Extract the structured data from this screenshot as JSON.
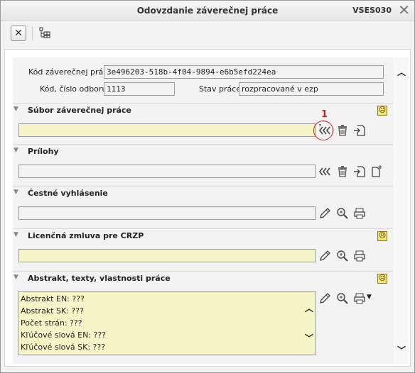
{
  "window": {
    "title": "Odovzdanie záverečnej práce",
    "app_code": "VSES030"
  },
  "header_fields": {
    "thesis_code_label": "Kód záverečnej práce",
    "thesis_code_value": "3e496203-518b-4f04-9894-e6b5efd224ea",
    "dept_code_label": "Kód, číslo odboru",
    "dept_code_value": "1113",
    "status_label": "Stav práce",
    "status_value": "rozpracované v ezp"
  },
  "sections": {
    "thesis_file": {
      "title": "Súbor záverečnej práce",
      "value": ""
    },
    "attachments": {
      "title": "Prílohy",
      "value": ""
    },
    "declaration": {
      "title": "Čestné vyhlásenie",
      "value": ""
    },
    "license": {
      "title": "Licenčná zmluva pre CRZP",
      "value": ""
    },
    "abstract": {
      "title": "Abstrakt, texty, vlastnosti práce",
      "lines": [
        "Abstrakt EN: ???",
        "Abstrakt SK: ???",
        "Počet strán: ???",
        "Kľúčové slová EN: ???",
        "Kľúčové slová SK: ???"
      ]
    }
  },
  "annotation": {
    "number": "1",
    "color": "#cc1d1d"
  },
  "colors": {
    "yellow_field": "#f5f5c8",
    "warning_smiley": "#f5e46a"
  }
}
